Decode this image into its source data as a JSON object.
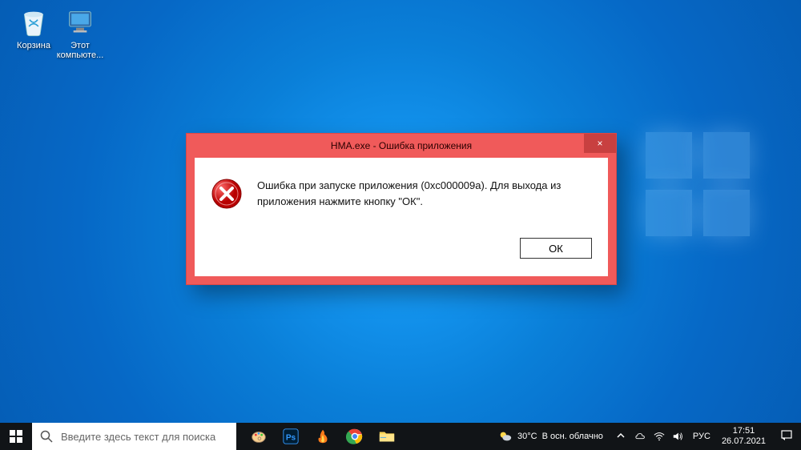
{
  "desktop": {
    "icons": {
      "recycle": "Корзина",
      "pc": "Этот компьюте..."
    }
  },
  "dialog": {
    "title": "HMA.exe - Ошибка приложения",
    "close": "×",
    "message": "Ошибка при запуске приложения (0xc000009a). Для выхода из приложения нажмите кнопку \"ОК\".",
    "ok": "ОК"
  },
  "taskbar": {
    "search_placeholder": "Введите здесь текст для поиска",
    "weather": {
      "temp": "30°C",
      "cond": "В осн. облачно"
    },
    "lang": "РУС",
    "time": "17:51",
    "date": "26.07.2021"
  }
}
